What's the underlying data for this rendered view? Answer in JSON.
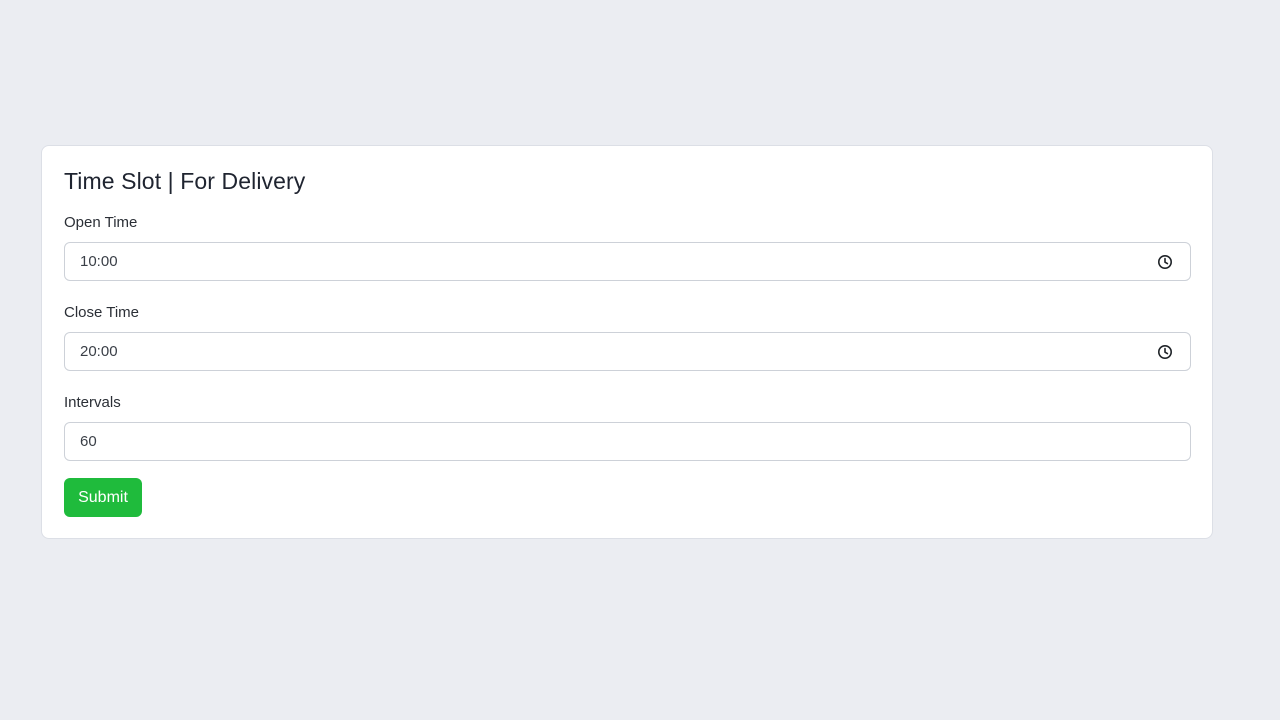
{
  "form": {
    "title": "Time Slot | For Delivery",
    "open_time": {
      "label": "Open Time",
      "value": "10:00"
    },
    "close_time": {
      "label": "Close Time",
      "value": "20:00"
    },
    "intervals": {
      "label": "Intervals",
      "value": "60"
    },
    "submit_label": "Submit"
  },
  "icons": {
    "time_picker": "clock-icon"
  },
  "colors": {
    "page_background": "#ebedf2",
    "submit_button": "#1fbb3c"
  }
}
